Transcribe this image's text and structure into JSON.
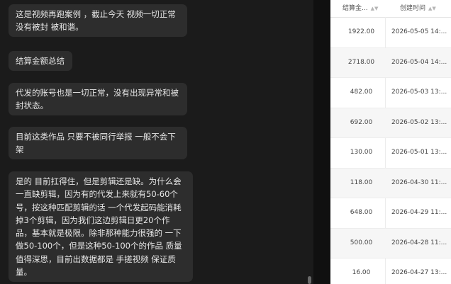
{
  "chat": {
    "messages": [
      {
        "text": "这是视频再跑案例 ，截止今天 视频一切正常没有被封 被和谐。"
      },
      {
        "text": "结算金额总结"
      },
      {
        "text": "代发的账号也是一切正常，没有出现异常和被封状态。"
      },
      {
        "text": "目前这类作品 只要不被同行举报  一般不会下架"
      },
      {
        "text": "是的 目前扛得住，但是剪辑还是缺。为什么会一直缺剪辑，因为有的代发上来就有50-60个号，按这种匹配剪辑的话 一个代发起码能消耗掉3个剪辑，因为我们这边剪辑日更20个作品，基本就是极限。除非那种能力很强的 一下做50-100个，但是这种50-100个的作品 质量值得深思，目前出数据都是 手搓视频 保证质量。"
      }
    ]
  },
  "table": {
    "headers": {
      "amount": "结算金...",
      "time": "创建时间"
    },
    "rows": [
      {
        "amount": "1922.00",
        "time": "2026-05-05 14:..."
      },
      {
        "amount": "2718.00",
        "time": "2026-05-04 14:..."
      },
      {
        "amount": "482.00",
        "time": "2026-05-03 13:..."
      },
      {
        "amount": "692.00",
        "time": "2026-05-02 13:..."
      },
      {
        "amount": "130.00",
        "time": "2026-05-01 13:..."
      },
      {
        "amount": "118.00",
        "time": "2026-04-30 11:..."
      },
      {
        "amount": "648.00",
        "time": "2026-04-29 11:..."
      },
      {
        "amount": "500.00",
        "time": "2026-04-28 11:..."
      },
      {
        "amount": "16.00",
        "time": "2026-04-27 13:..."
      }
    ]
  }
}
